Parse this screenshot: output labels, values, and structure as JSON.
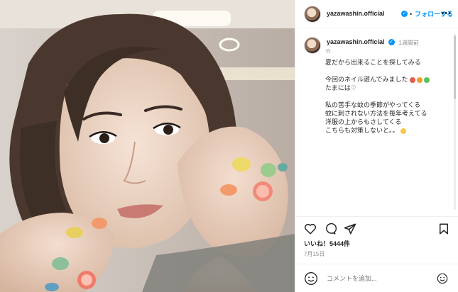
{
  "post": {
    "username": "yazawashin.official",
    "follow_label": "フォローする",
    "dot_separator": "•",
    "time_ago": "1週間前",
    "caption_lines": [
      "☆",
      "夏だから出来ることを探してみる",
      "今回のネイル遊んでみました",
      "たまには♡",
      "私の苦手な蚊の季節がやってくる",
      "蚊に刺されない方法を毎年考えてる",
      "洋服の上からもさしてくる",
      "こちらも対策しないと。。"
    ],
    "likes_text": "いいね！5444件",
    "date": "7月15日",
    "comment_placeholder": "コメントを追加..."
  },
  "icons": {
    "more": "more-icon",
    "heart": "heart-icon",
    "comment": "comment-icon",
    "share": "share-icon",
    "bookmark": "bookmark-icon",
    "emoji": "emoji-icon",
    "verified": "verified-icon"
  },
  "colors": {
    "accent": "#0095f6",
    "text": "#262626",
    "muted": "#8e8e8e"
  }
}
